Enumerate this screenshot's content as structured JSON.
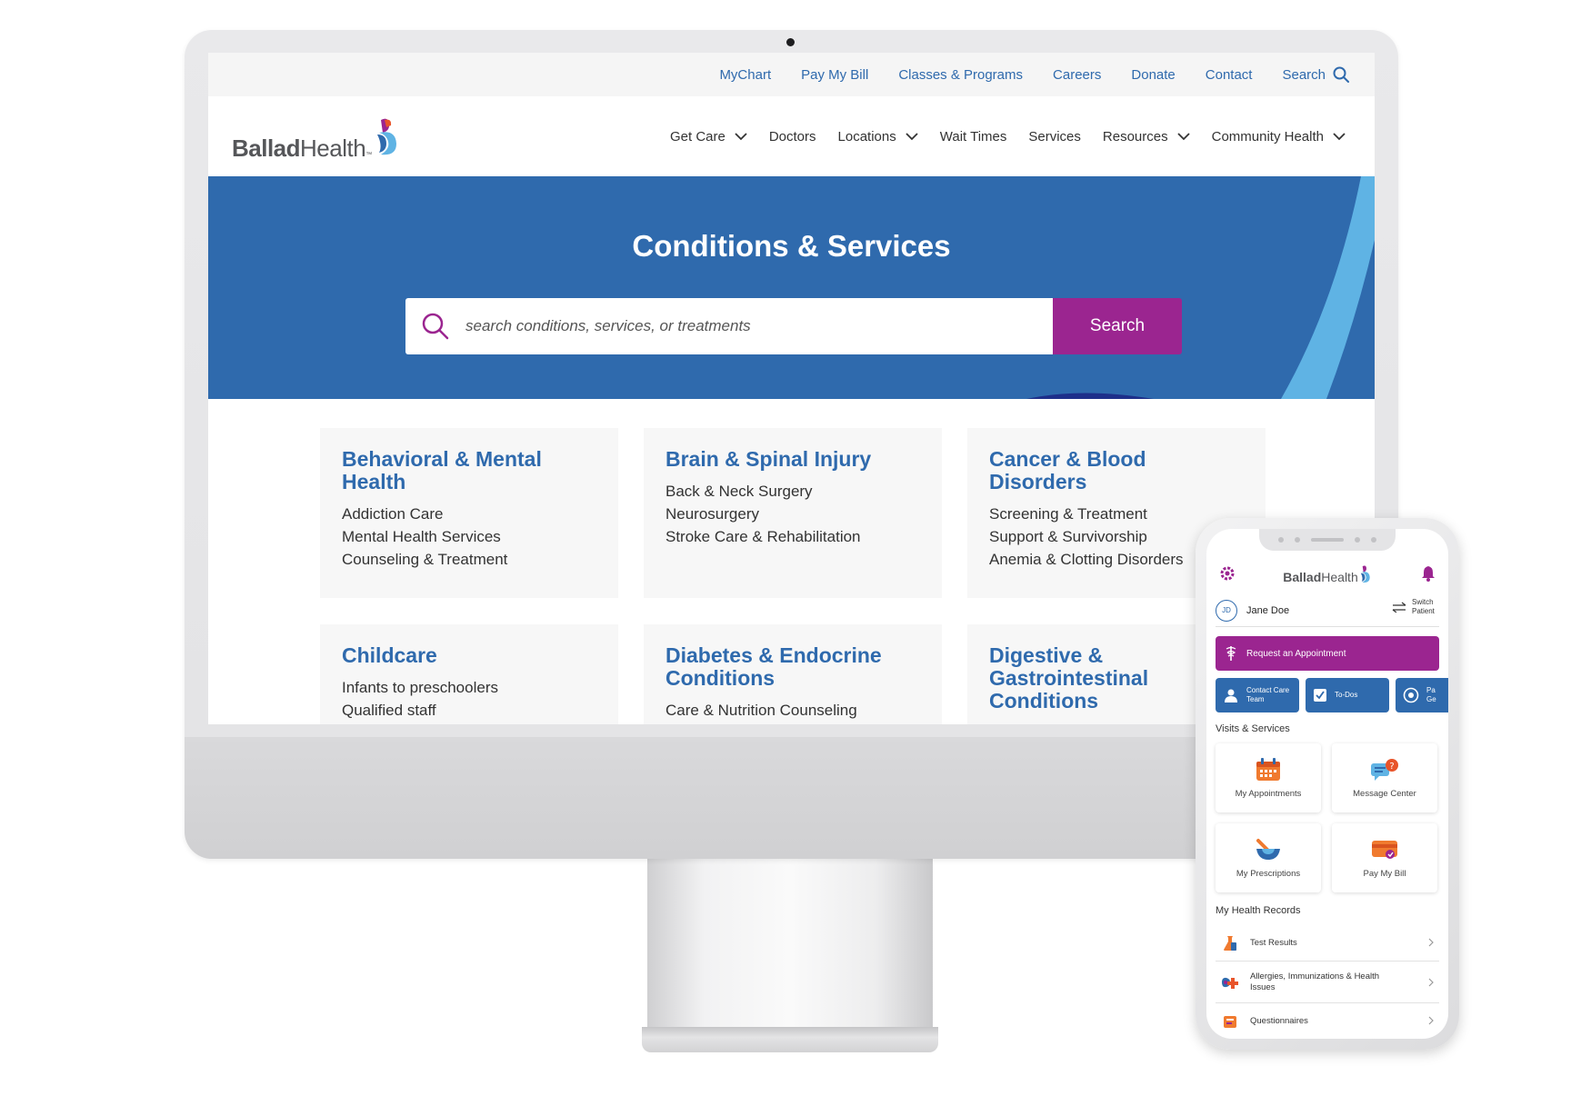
{
  "desktop": {
    "utility_nav": [
      "MyChart",
      "Pay My Bill",
      "Classes & Programs",
      "Careers",
      "Donate",
      "Contact"
    ],
    "utility_search_label": "Search",
    "logo": {
      "bold": "Ballad",
      "light": "Health",
      "tm": "™"
    },
    "main_nav": [
      {
        "label": "Get Care",
        "dropdown": true
      },
      {
        "label": "Doctors",
        "dropdown": false
      },
      {
        "label": "Locations",
        "dropdown": true
      },
      {
        "label": "Wait Times",
        "dropdown": false
      },
      {
        "label": "Services",
        "dropdown": false
      },
      {
        "label": "Resources",
        "dropdown": true
      },
      {
        "label": "Community Health",
        "dropdown": true
      }
    ],
    "hero": {
      "title": "Conditions & Services",
      "search_placeholder": "search conditions, services, or treatments",
      "search_button": "Search"
    },
    "cards": [
      {
        "title": "Behavioral & Mental Health",
        "items": [
          "Addiction Care",
          "Mental Health Services",
          "Counseling & Treatment"
        ]
      },
      {
        "title": "Brain & Spinal Injury",
        "items": [
          "Back & Neck Surgery",
          "Neurosurgery",
          "Stroke Care & Rehabilitation"
        ]
      },
      {
        "title": "Cancer & Blood Disorders",
        "items": [
          "Screening & Treatment",
          "Support & Survivorship",
          "Anemia & Clotting Disorders"
        ]
      },
      {
        "title": "Childcare",
        "items": [
          "Infants to preschoolers",
          "Qualified staff"
        ]
      },
      {
        "title": "Diabetes & Endocrine Conditions",
        "items": [
          "Care & Nutrition Counseling"
        ]
      },
      {
        "title": "Digestive & Gastrointestinal Conditions",
        "items": []
      }
    ],
    "colors": {
      "primary_blue": "#2f6aad",
      "accent_purple": "#9b2590",
      "light_blue": "#5fb3e4"
    }
  },
  "mobile": {
    "logo": {
      "bold": "Ballad",
      "light": "Health"
    },
    "patient": {
      "initials": "JD",
      "name": "Jane Doe",
      "switch_label": "Switch Patient"
    },
    "request_appointment": "Request an Appointment",
    "quick_actions": [
      "Contact Care Team",
      "To-Dos",
      "Pa Ge"
    ],
    "visits_title": "Visits & Services",
    "visits": [
      "My Appointments",
      "Message Center",
      "My Prescriptions",
      "Pay My Bill"
    ],
    "records_title": "My Health Records",
    "records": [
      "Test Results",
      "Allergies, Immunizations & Health Issues",
      "Questionnaires"
    ]
  }
}
